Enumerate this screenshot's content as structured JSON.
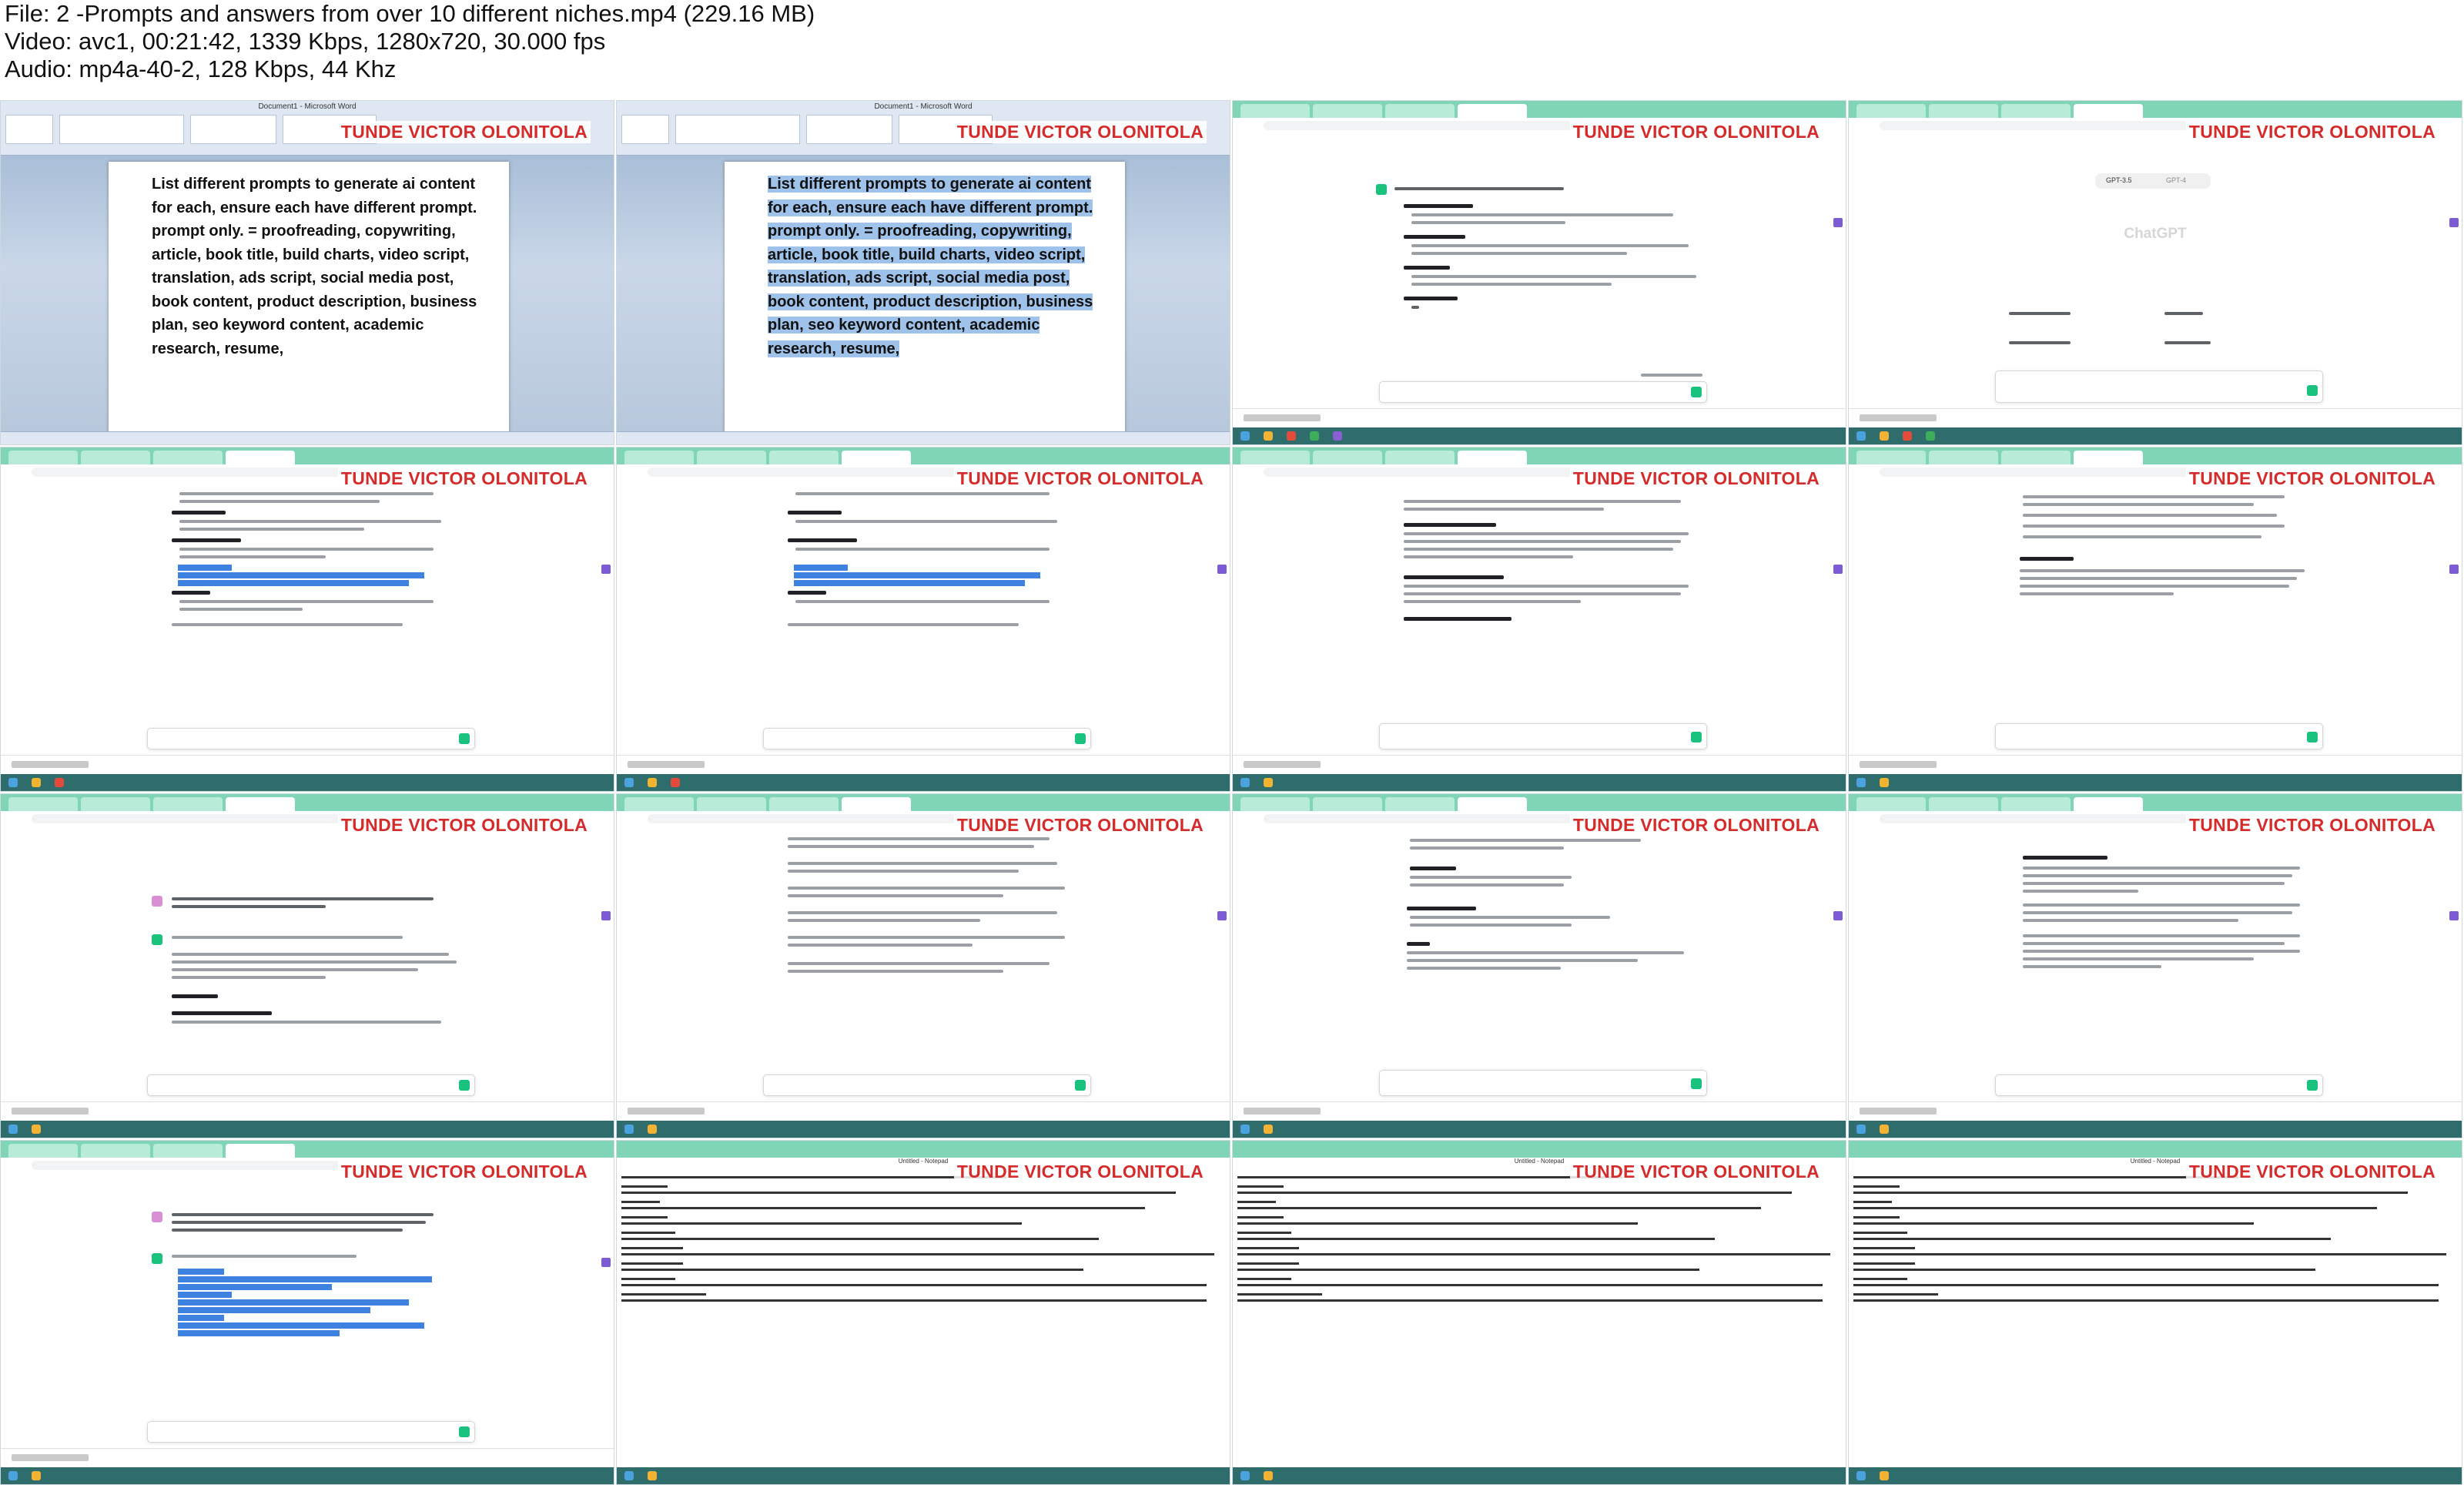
{
  "header": {
    "file_line": "File: 2 -Prompts and answers from over 10 different niches.mp4 (229.16 MB)",
    "video_line": "Video: avc1, 00:21:42, 1339 Kbps, 1280x720, 30.000 fps",
    "audio_line": "Audio: mp4a-40-2, 128 Kbps, 44 Khz"
  },
  "watermark": "TUNDE VICTOR OLONITOLA",
  "word_doc": {
    "window_title": "Document1 - Microsoft Word",
    "prompt_text": "List different prompts to generate ai content for each, ensure each have different prompt. prompt only. = proofreading, copywriting, article, book title, build charts, video script, translation, ads script, social media post, book content, product description, business plan, seo keyword content, academic research, resume,"
  },
  "chatgpt": {
    "logo_text": "ChatGPT",
    "model_tab_1": "GPT-3.5",
    "model_tab_2": "GPT-4",
    "url": "chat.openai.com"
  },
  "notepad": {
    "window_title": "Untitled - Notepad"
  },
  "colors": {
    "watermark": "#d52b2b",
    "tabbar": "#7fd5b6",
    "taskbar": "#2e6d6b",
    "highlight": "#3d82e0",
    "send": "#19c37d"
  }
}
